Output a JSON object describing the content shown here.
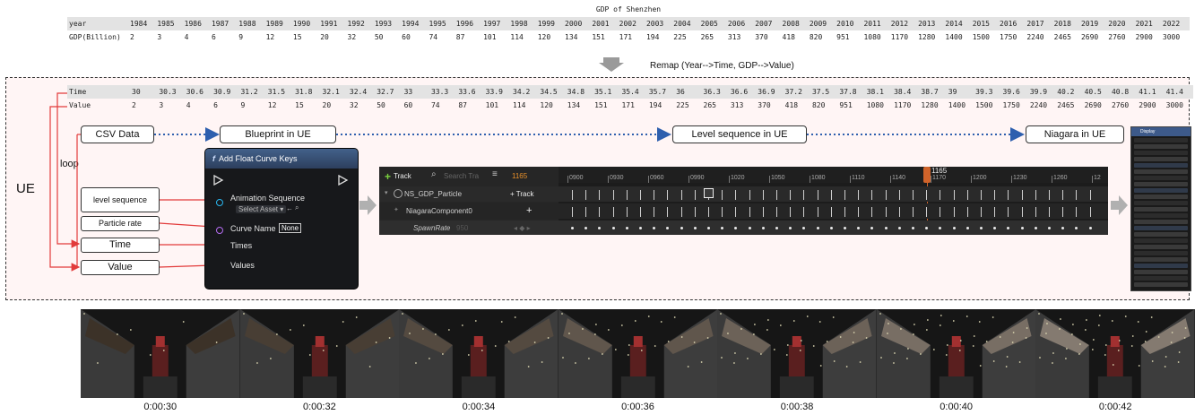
{
  "gdp_table": {
    "title": "GDP of Shenzhen",
    "row1_header": "year",
    "row2_header": "GDP(Billion)",
    "years": [
      "1984",
      "1985",
      "1986",
      "1987",
      "1988",
      "1989",
      "1990",
      "1991",
      "1992",
      "1993",
      "1994",
      "1995",
      "1996",
      "1997",
      "1998",
      "1999",
      "2000",
      "2001",
      "2002",
      "2003",
      "2004",
      "2005",
      "2006",
      "2007",
      "2008",
      "2009",
      "2010",
      "2011",
      "2012",
      "2013",
      "2014",
      "2015",
      "2016",
      "2017",
      "2018",
      "2019",
      "2020",
      "2021",
      "2022"
    ],
    "gdp": [
      "2",
      "3",
      "4",
      "6",
      "9",
      "12",
      "15",
      "20",
      "32",
      "50",
      "60",
      "74",
      "87",
      "101",
      "114",
      "120",
      "134",
      "151",
      "171",
      "194",
      "225",
      "265",
      "313",
      "370",
      "418",
      "820",
      "951",
      "1080",
      "1170",
      "1280",
      "1400",
      "1500",
      "1750",
      "2240",
      "2465",
      "2690",
      "2760",
      "2900",
      "3000"
    ]
  },
  "remap_label": "Remap (Year-->Time, GDP-->Value)",
  "ue_region": {
    "label": "UE",
    "loop_label": "loop",
    "time_header": "Time",
    "value_header": "Value",
    "times": [
      "30",
      "30.3",
      "30.6",
      "30.9",
      "31.2",
      "31.5",
      "31.8",
      "32.1",
      "32.4",
      "32.7",
      "33",
      "33.3",
      "33.6",
      "33.9",
      "34.2",
      "34.5",
      "34.8",
      "35.1",
      "35.4",
      "35.7",
      "36",
      "36.3",
      "36.6",
      "36.9",
      "37.2",
      "37.5",
      "37.8",
      "38.1",
      "38.4",
      "38.7",
      "39",
      "39.3",
      "39.6",
      "39.9",
      "40.2",
      "40.5",
      "40.8",
      "41.1",
      "41.4"
    ],
    "values": [
      "2",
      "3",
      "4",
      "6",
      "9",
      "12",
      "15",
      "20",
      "32",
      "50",
      "60",
      "74",
      "87",
      "101",
      "114",
      "120",
      "134",
      "151",
      "171",
      "194",
      "225",
      "265",
      "313",
      "370",
      "418",
      "820",
      "951",
      "1080",
      "1170",
      "1280",
      "1400",
      "1500",
      "1750",
      "2240",
      "2465",
      "2690",
      "2760",
      "2900",
      "3000"
    ]
  },
  "flow": {
    "csv": "CSV Data",
    "blueprint": "Blueprint in UE",
    "sequence": "Level sequence in UE",
    "niagara": "Niagara in UE"
  },
  "inputs": {
    "level_sequence": "level sequence",
    "particle_rate": "Particle rate",
    "time": "Time",
    "value": "Value"
  },
  "blueprint_node": {
    "title": "Add Float Curve Keys",
    "anim_seq": "Animation Sequence",
    "select_asset": "Select Asset ▾",
    "curve_name": "Curve Name",
    "curve_value": "None",
    "times": "Times",
    "values": "Values"
  },
  "sequencer": {
    "track_btn": "Track",
    "search_placeholder": "Search Tra",
    "frame": "1165",
    "playhead": "1165",
    "row1": "NS_GDP_Particle",
    "row1_btn": "Track",
    "row2": "NiagaraComponent0",
    "row3": "SpawnRate",
    "row3_value": "950",
    "ruler_ticks": [
      "0900",
      "0930",
      "0960",
      "0990",
      "1020",
      "1050",
      "1080",
      "1110",
      "1140",
      "1170",
      "1200",
      "1230",
      "1260",
      "12"
    ]
  },
  "niagara_panel": {
    "header": "Display"
  },
  "film": {
    "timestamps": [
      "0:00:30",
      "0:00:32",
      "0:00:34",
      "0:00:36",
      "0:00:38",
      "0:00:40",
      "0:00:42"
    ]
  }
}
